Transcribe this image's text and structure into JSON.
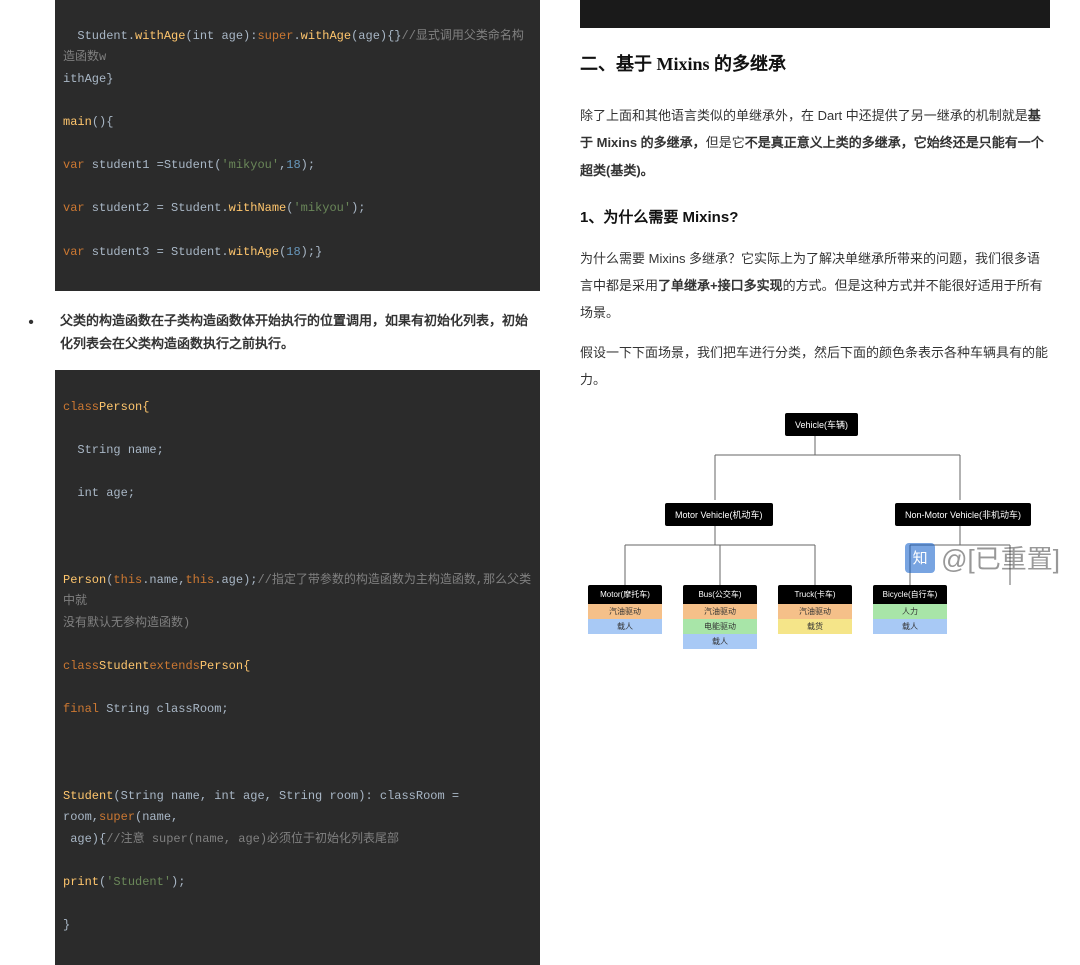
{
  "left": {
    "code1": {
      "l1_pre": "  Student.",
      "l1_withAge": "withAge",
      "l1_mid": "(int age):",
      "l1_super": "super",
      "l1_dot": ".",
      "l1_call": "withAge",
      "l1_post": "(age){}",
      "l1_cmt": "//显式调用父类命名构造函数w",
      "l2": "ithAge}",
      "l3a": "main",
      "l3b": "(){",
      "l4_var": "var",
      "l4_mid": " student1 =",
      "l4_typ": "Student",
      "l4_p": "(",
      "l4_s": "'mikyou'",
      "l4_c": ",",
      "l4_n": "18",
      "l4_e": ");",
      "l5_var": "var",
      "l5_mid": " student2 = Student.",
      "l5_call": "withName",
      "l5_p": "(",
      "l5_s": "'mikyou'",
      "l5_e": ");",
      "l6_var": "var",
      "l6_mid": " student3 = Student.",
      "l6_call": "withAge",
      "l6_p": "(",
      "l6_n": "18",
      "l6_e": ");}"
    },
    "bullet": "父类的构造函数在子类构造函数体开始执行的位置调用，如果有初始化列表，初始化列表会在父类构造函数执行之前执行。",
    "code2": {
      "l1a": "class",
      "l1b": "Person{",
      "l2": "  String name;",
      "l3": "  int age;",
      "l4a": "Person",
      "l4b": "(",
      "l4c": "this",
      "l4d": ".name,",
      "l4e": "this",
      "l4f": ".age);",
      "l4cmt": "//指定了带参数的构造函数为主构造函数,那么父类中就",
      "l4cmt2": "没有默认无参构造函数)",
      "l5a": "class",
      "l5b": "Student",
      "l5c": "extends",
      "l5d": "Person{",
      "l6a": "final",
      "l6b": " String classRoom;",
      "l7a": "Student",
      "l7b": "(String name, int age, String room): classRoom = room,",
      "l7c": "super",
      "l7d": "(name,",
      "l7e": " age){",
      "l7cmt": "//注意 super(name, age)必须位于初始化列表尾部",
      "l8a": "print",
      "l8b": "(",
      "l8c": "'Student'",
      "l8d": ");",
      "l9": "}"
    }
  },
  "right": {
    "h2": "二、基于 Mixins 的多继承",
    "p1_a": "除了上面和其他语言类似的单继承外，在 Dart 中还提供了另一继承的机制就是",
    "p1_b": "基于 Mixins 的多继承，",
    "p1_c": "但是它",
    "p1_d": "不是真正意义上类的多继承，它始终还是只能有一个超类(基类)。",
    "h3": "1、为什么需要 Mixins?",
    "p2_a": "为什么需要 Mixins 多继承？它实际上为了解决单继承所带来的问题，我们很多语言中都是采用",
    "p2_b": "了单继承+接口多实现",
    "p2_c": "的方式。但是这种方式并不能很好适用于所有场景。",
    "p3": "假设一下下面场景，我们把车进行分类，然后下面的颜色条表示各种车辆具有的能力。",
    "diagram": {
      "root": "Vehicle(车辆)",
      "mid1": "Motor Vehicle(机动车)",
      "mid2": "Non-Motor Vehicle(非机动车)",
      "leaf1": {
        "title": "Motor(摩托车)",
        "caps": [
          "汽油驱动",
          "载人"
        ]
      },
      "leaf2": {
        "title": "Bus(公交车)",
        "caps": [
          "汽油驱动",
          "电能驱动",
          "载人"
        ]
      },
      "leaf3": {
        "title": "Truck(卡车)",
        "caps": [
          "汽油驱动",
          "载货"
        ]
      },
      "leaf4": {
        "title": "Bicycle(自行车)",
        "caps": [
          "人力",
          "载人"
        ]
      }
    }
  },
  "watermark": "@[已重置]",
  "zhihu": "知"
}
